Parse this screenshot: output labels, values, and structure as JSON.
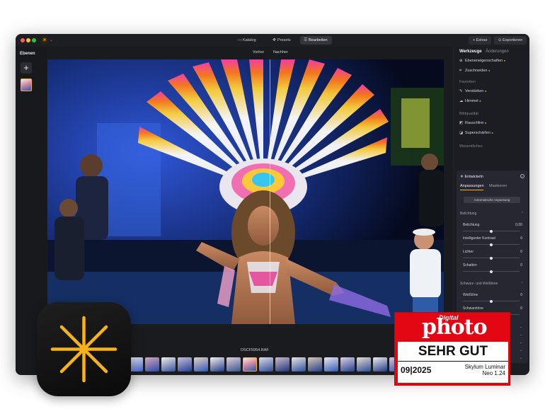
{
  "window": {
    "tabs": [
      {
        "label": "Katalog",
        "icon": "folder-icon",
        "active": false
      },
      {
        "label": "Presets",
        "icon": "presets-icon",
        "active": false
      },
      {
        "label": "Bearbeiten",
        "icon": "sliders-icon",
        "active": true
      }
    ],
    "extras_label": "Extras",
    "export_label": "Exportieren"
  },
  "layers": {
    "title": "Ebenen",
    "add_symbol": "+"
  },
  "canvas": {
    "before_label": "Vorher",
    "after_label": "Nachher",
    "filename": "DSCF5954.RAF"
  },
  "panel": {
    "tab_tools": "Werkzeuge",
    "tab_changes": "Änderungen",
    "items_top": [
      {
        "icon": "layer-properties-icon",
        "label": "Ebeneneigenschaften",
        "badge": "pro"
      },
      {
        "icon": "crop-icon",
        "label": "Zuschneiden",
        "badge": "ai"
      }
    ],
    "section_favorites": "Favoriten",
    "items_favorites": [
      {
        "icon": "enhance-icon",
        "label": "Verstärken",
        "badge": "ai"
      },
      {
        "icon": "sky-icon",
        "label": "Himmel",
        "badge": "ai"
      }
    ],
    "section_quality": "Bildqualität",
    "items_quality": [
      {
        "icon": "noise-icon",
        "label": "Rauschfrei",
        "badge": "ai"
      },
      {
        "icon": "supersharp-icon",
        "label": "Superschärfen",
        "badge": "ai"
      }
    ],
    "section_essentials": "Wesentliches",
    "develop": {
      "title": "Entwickeln",
      "tab_adjust": "Anpassungen",
      "tab_mask": "Maskieren",
      "auto_button": "Automatische Anpassung",
      "group_exposure": "Belichtung",
      "exposure_sliders": [
        {
          "label": "Belichtung",
          "value": "0.00",
          "level": 0.5
        },
        {
          "label": "Intelligenter Kontrast",
          "value": "0",
          "level": 0.5
        },
        {
          "label": "Lichter",
          "value": "0",
          "level": 0.5
        },
        {
          "label": "Schatten",
          "value": "0",
          "level": 0.5
        }
      ],
      "group_bw": "Schwarz- und Weißtöne",
      "bw_sliders": [
        {
          "label": "Weißtöne",
          "value": "0",
          "level": 0.5
        },
        {
          "label": "Schwarztöne",
          "value": "0",
          "level": 0.5
        }
      ],
      "collapsed_groups": 5
    }
  },
  "badge": {
    "small": "Digital",
    "brand": "photo",
    "verdict": "SEHR GUT",
    "date": "09|2025",
    "product_line1": "Skylum Luminar",
    "product_line2": "Neo 1.24"
  },
  "colors": {
    "accent": "#f5b21b",
    "badge_red": "#e30613",
    "panel_bg": "#1c1d22"
  }
}
